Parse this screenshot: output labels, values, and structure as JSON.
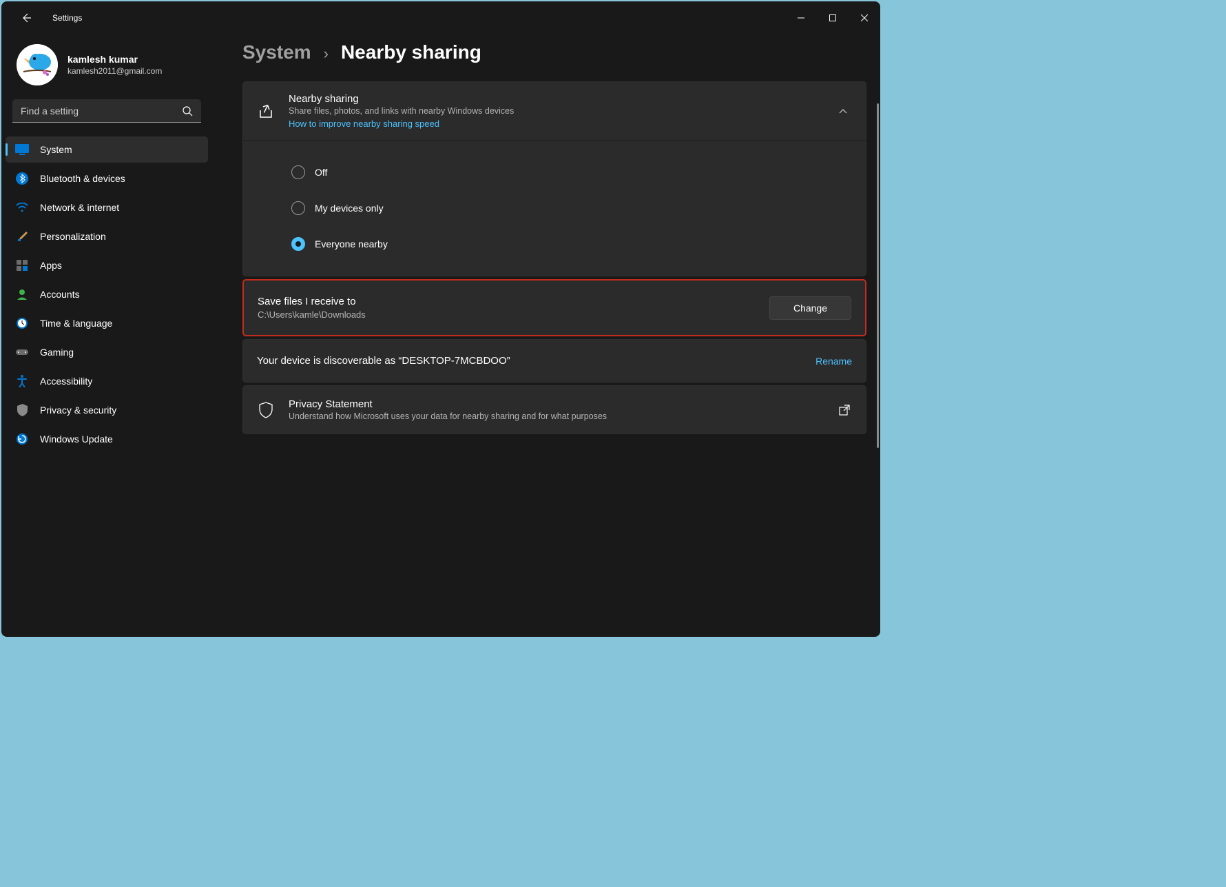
{
  "window": {
    "title": "Settings"
  },
  "profile": {
    "name": "kamlesh kumar",
    "email": "kamlesh2011@gmail.com"
  },
  "search": {
    "placeholder": "Find a setting"
  },
  "sidebar": {
    "items": [
      {
        "label": "System",
        "active": true
      },
      {
        "label": "Bluetooth & devices"
      },
      {
        "label": "Network & internet"
      },
      {
        "label": "Personalization"
      },
      {
        "label": "Apps"
      },
      {
        "label": "Accounts"
      },
      {
        "label": "Time & language"
      },
      {
        "label": "Gaming"
      },
      {
        "label": "Accessibility"
      },
      {
        "label": "Privacy & security"
      },
      {
        "label": "Windows Update"
      }
    ]
  },
  "breadcrumb": {
    "parent": "System",
    "current": "Nearby sharing"
  },
  "nearby": {
    "title": "Nearby sharing",
    "subtitle": "Share files, photos, and links with nearby Windows devices",
    "link": "How to improve nearby sharing speed",
    "options": {
      "off": "Off",
      "my_devices": "My devices only",
      "everyone": "Everyone nearby"
    },
    "selected": "everyone"
  },
  "save": {
    "title": "Save files I receive to",
    "path": "C:\\Users\\kamle\\Downloads",
    "button": "Change"
  },
  "discover": {
    "text": "Your device is discoverable as “DESKTOP-7MCBDOO”",
    "rename": "Rename"
  },
  "privacy": {
    "title": "Privacy Statement",
    "subtitle": "Understand how Microsoft uses your data for nearby sharing and for what purposes"
  }
}
